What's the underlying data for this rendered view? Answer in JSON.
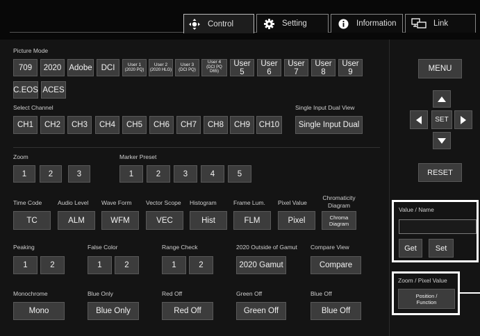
{
  "tabs": [
    {
      "label": "Control",
      "icon": "move-arrows-icon",
      "active": true
    },
    {
      "label": "Setting",
      "icon": "gear-icon",
      "active": false
    },
    {
      "label": "Information",
      "icon": "info-circle-icon",
      "active": false
    },
    {
      "label": "Link",
      "icon": "monitors-link-icon",
      "active": false
    }
  ],
  "picture_mode": {
    "label": "Picture Mode",
    "buttons": [
      "709",
      "2020",
      "Adobe",
      "DCI",
      "User 5",
      "User 6",
      "User 7",
      "User 8",
      "User 9",
      "C.EOS",
      "ACES"
    ],
    "user1": [
      "User 1",
      "(2020 PQ)"
    ],
    "user2": [
      "User 2",
      "(2020 HLG)"
    ],
    "user3": [
      "User 3",
      "(DCI PQ)"
    ],
    "user4": [
      "User 4",
      "(DCI PQ",
      "D65)"
    ]
  },
  "select_channel": {
    "label": "Select Channel",
    "buttons": [
      "CH1",
      "CH2",
      "CH3",
      "CH4",
      "CH5",
      "CH6",
      "CH7",
      "CH8",
      "CH9",
      "CH10"
    ]
  },
  "single_input": {
    "label": "Single Input Dual View",
    "button": "Single Input Dual"
  },
  "zoom": {
    "label": "Zoom",
    "buttons": [
      "1",
      "2",
      "3"
    ]
  },
  "marker": {
    "label": "Marker Preset",
    "buttons": [
      "1",
      "2",
      "3",
      "4",
      "5"
    ]
  },
  "functions": {
    "labels": [
      "Time Code",
      "Audio Level",
      "Wave Form",
      "Vector Scope",
      "Histogram",
      "Frame Lum.",
      "Pixel Value"
    ],
    "chroma_label": [
      "Chromaticity",
      "Diagram"
    ],
    "buttons": [
      "TC",
      "ALM",
      "WFM",
      "VEC",
      "Hist",
      "FLM",
      "Pixel"
    ],
    "chroma_button": [
      "Chroma",
      "Diagram"
    ]
  },
  "peaking": {
    "label": "Peaking",
    "buttons": [
      "1",
      "2"
    ]
  },
  "false_color": {
    "label": "False Color",
    "buttons": [
      "1",
      "2"
    ]
  },
  "range_check": {
    "label": "Range Check",
    "buttons": [
      "1",
      "2"
    ]
  },
  "gamut": {
    "label": "2020 Outside of Gamut",
    "button": "2020 Gamut"
  },
  "compare": {
    "label": "Compare View",
    "button": "Compare"
  },
  "bottom_row": {
    "labels": [
      "Monochrome",
      "Blue Only",
      "Red Off",
      "Green Off",
      "Blue Off"
    ],
    "buttons": [
      "Mono",
      "Blue Only",
      "Red Off",
      "Green Off",
      "Blue Off"
    ]
  },
  "right_panel": {
    "menu": "MENU",
    "set": "SET",
    "reset": "RESET",
    "value_name_label": "Value / Name",
    "value_input": "",
    "get": "Get",
    "set_value": "Set",
    "zoom_pixel_label": "Zoom / Pixel Value",
    "position_function": [
      "Position /",
      "Function"
    ]
  },
  "colors": {
    "highlight": "#ffffff",
    "button_bg": "#3c3c3c",
    "background": "#141414"
  }
}
